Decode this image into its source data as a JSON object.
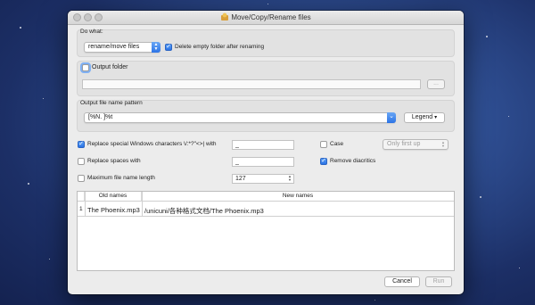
{
  "window": {
    "title": "Move/Copy/Rename files"
  },
  "do_what": {
    "label": "Do what:",
    "action_value": "rename/move files",
    "delete_empty_label": "Delete empty folder after renaming",
    "delete_empty_checked": true
  },
  "output_folder": {
    "label": "Output folder",
    "checked": false,
    "path_value": "",
    "browse_label": "..."
  },
  "pattern": {
    "label": "Output file name pattern",
    "value": "[%N. ]%t",
    "legend_label": "Legend",
    "legend_arrow": "▾"
  },
  "options": {
    "replace_special_label": "Replace special Windows characters \\/:*?\"<>| with",
    "replace_special_checked": true,
    "replace_special_value": "_",
    "replace_spaces_label": "Replace spaces with",
    "replace_spaces_checked": false,
    "replace_spaces_value": "_",
    "max_length_label": "Maximum file name length",
    "max_length_checked": false,
    "max_length_value": "127",
    "case_label": "Case",
    "case_checked": false,
    "case_value": "Only first up",
    "remove_diacritics_label": "Remove diacritics",
    "remove_diacritics_checked": true
  },
  "table": {
    "headers": [
      "Old names",
      "New names"
    ],
    "rows": [
      {
        "index": "1",
        "old": "The Phoenix.mp3",
        "new": "/unicuni/各种格式文档/The Phoenix.mp3"
      }
    ]
  },
  "footer": {
    "cancel_label": "Cancel",
    "run_label": "Run"
  },
  "colors": {
    "accent": "#2a72e5",
    "window_bg": "#ececec",
    "desktop": "#2f4f93"
  }
}
